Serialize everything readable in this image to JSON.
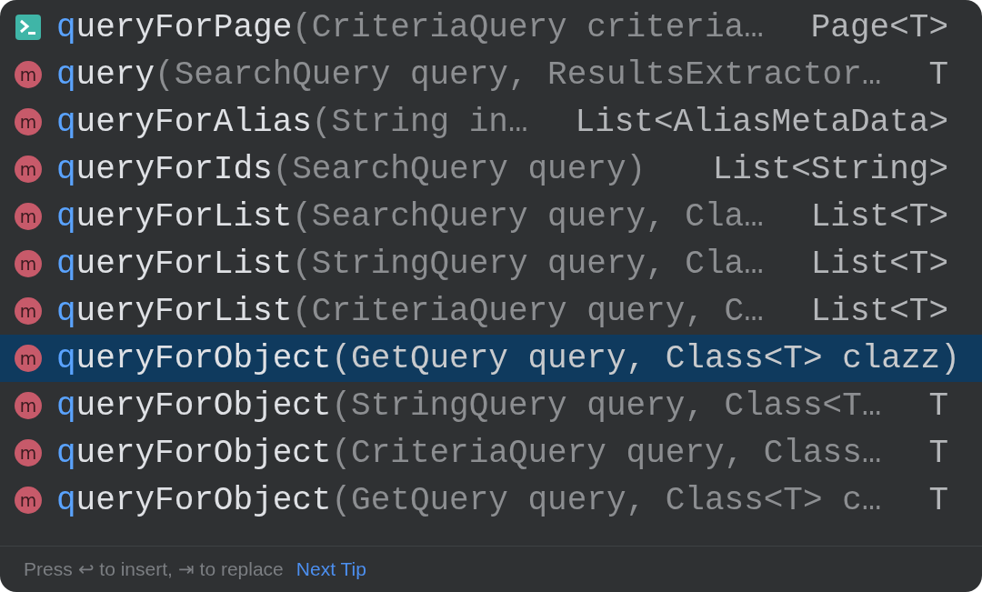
{
  "completions": [
    {
      "kind": "live_template",
      "match": "q",
      "name": "ueryForPage",
      "params": "(CriteriaQuery criteria…",
      "type": "Page<T>",
      "selected": false
    },
    {
      "kind": "method",
      "badge": "m",
      "match": "q",
      "name": "uery",
      "params": "(SearchQuery query, ResultsExtractor…",
      "type": "T",
      "selected": false
    },
    {
      "kind": "method",
      "badge": "m",
      "match": "q",
      "name": "ueryForAlias",
      "params": "(String in…",
      "type": "List<AliasMetaData>",
      "selected": false
    },
    {
      "kind": "method",
      "badge": "m",
      "match": "q",
      "name": "ueryForIds",
      "params": "(SearchQuery query)",
      "type": "List<String>",
      "selected": false
    },
    {
      "kind": "method",
      "badge": "m",
      "match": "q",
      "name": "ueryForList",
      "params": "(SearchQuery query, Cla…",
      "type": "List<T>",
      "selected": false
    },
    {
      "kind": "method",
      "badge": "m",
      "match": "q",
      "name": "ueryForList",
      "params": "(StringQuery query, Cla…",
      "type": "List<T>",
      "selected": false
    },
    {
      "kind": "method",
      "badge": "m",
      "match": "q",
      "name": "ueryForList",
      "params": "(CriteriaQuery query, C…",
      "type": "List<T>",
      "selected": false
    },
    {
      "kind": "method",
      "badge": "m",
      "match": "q",
      "name": "ueryForObject",
      "params": "(GetQuery query, Class<T> clazz)",
      "selected": true
    },
    {
      "kind": "method",
      "badge": "m",
      "match": "q",
      "name": "ueryForObject",
      "params": "(StringQuery query, Class<T…",
      "type": "T",
      "selected": false
    },
    {
      "kind": "method",
      "badge": "m",
      "match": "q",
      "name": "ueryForObject",
      "params": "(CriteriaQuery query, Class…",
      "type": "T",
      "selected": false
    },
    {
      "kind": "method",
      "badge": "m",
      "match": "q",
      "name": "ueryForObject",
      "params": "(GetQuery query, Class<T> c…",
      "type": "T",
      "selected": false
    }
  ],
  "footer": {
    "hint": "Press ↩ to insert, ⇥ to replace",
    "link": "Next Tip"
  }
}
